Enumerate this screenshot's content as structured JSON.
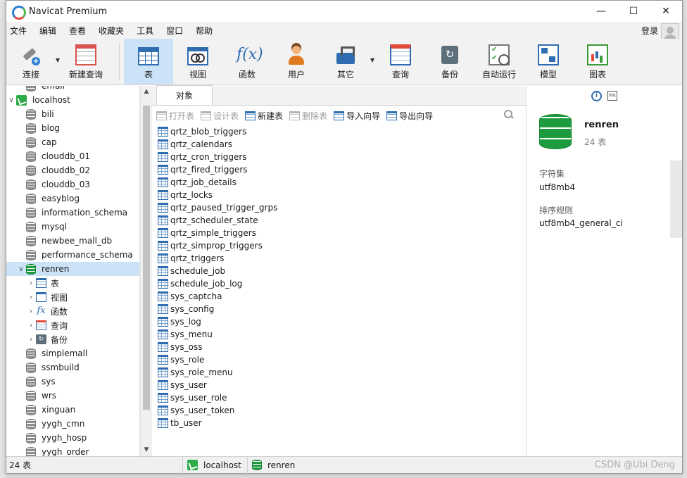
{
  "window": {
    "title": "Navicat Premium",
    "controls": {
      "minimize": "—",
      "maximize": "☐",
      "close": "✕"
    }
  },
  "menu": {
    "items": [
      "文件",
      "编辑",
      "查看",
      "收藏夹",
      "工具",
      "窗口",
      "帮助"
    ],
    "login": "登录"
  },
  "toolbar": {
    "buttons": [
      {
        "label": "连接",
        "icon": "connection-icon"
      },
      {
        "label": "新建查询",
        "icon": "new-query-icon"
      },
      {
        "label": "表",
        "icon": "table-icon",
        "active": true
      },
      {
        "label": "视图",
        "icon": "view-icon"
      },
      {
        "label": "函数",
        "icon": "function-icon",
        "glyph": "f(x)"
      },
      {
        "label": "用户",
        "icon": "user-icon"
      },
      {
        "label": "其它",
        "icon": "tools-icon"
      },
      {
        "label": "查询",
        "icon": "query-icon"
      },
      {
        "label": "备份",
        "icon": "backup-icon"
      },
      {
        "label": "自动运行",
        "icon": "automation-icon"
      },
      {
        "label": "模型",
        "icon": "model-icon"
      },
      {
        "label": "图表",
        "icon": "chart-icon"
      }
    ]
  },
  "nav": {
    "partial_top": "email",
    "connection": "localhost",
    "databases_before": [
      "bili",
      "blog",
      "cap",
      "clouddb_01",
      "clouddb_02",
      "clouddb_03",
      "easyblog",
      "information_schema",
      "mysql",
      "newbee_mall_db",
      "performance_schema"
    ],
    "selected_db": "renren",
    "children": [
      {
        "label": "表",
        "icon": "table"
      },
      {
        "label": "视图",
        "icon": "view"
      },
      {
        "label": "函数",
        "icon": "func",
        "glyph": "fx"
      },
      {
        "label": "查询",
        "icon": "query"
      },
      {
        "label": "备份",
        "icon": "backup",
        "glyph": "↻"
      }
    ],
    "databases_after": [
      "simplemall",
      "ssmbuild",
      "sys",
      "wrs",
      "xinguan",
      "yygh_cmn",
      "yygh_hosp",
      "yygh_order"
    ]
  },
  "content": {
    "tab": "对象",
    "actions": [
      {
        "label": "打开表",
        "disabled": true
      },
      {
        "label": "设计表",
        "disabled": true
      },
      {
        "label": "新建表",
        "disabled": false
      },
      {
        "label": "删除表",
        "disabled": true
      },
      {
        "label": "导入向导",
        "disabled": false
      },
      {
        "label": "导出向导",
        "disabled": false
      }
    ],
    "tables": [
      "qrtz_blob_triggers",
      "qrtz_calendars",
      "qrtz_cron_triggers",
      "qrtz_fired_triggers",
      "qrtz_job_details",
      "qrtz_locks",
      "qrtz_paused_trigger_grps",
      "qrtz_scheduler_state",
      "qrtz_simple_triggers",
      "qrtz_simprop_triggers",
      "qrtz_triggers",
      "schedule_job",
      "schedule_job_log",
      "sys_captcha",
      "sys_config",
      "sys_log",
      "sys_menu",
      "sys_oss",
      "sys_role",
      "sys_role_menu",
      "sys_user",
      "sys_user_role",
      "sys_user_token",
      "tb_user"
    ]
  },
  "info": {
    "i_glyph": "i",
    "ddl_glyph": "DDL",
    "db_name": "renren",
    "table_count": "24 表",
    "charset_label": "字符集",
    "charset_value": "utf8mb4",
    "collation_label": "排序规则",
    "collation_value": "utf8mb4_general_ci"
  },
  "status": {
    "count": "24 表",
    "connection": "localhost",
    "database": "renren",
    "watermark": "CSDN @Ubi Deng"
  },
  "colors": {
    "selection": "#cce3f7",
    "db_green": "#1d9b3e",
    "accent_blue": "#2f6db0"
  }
}
